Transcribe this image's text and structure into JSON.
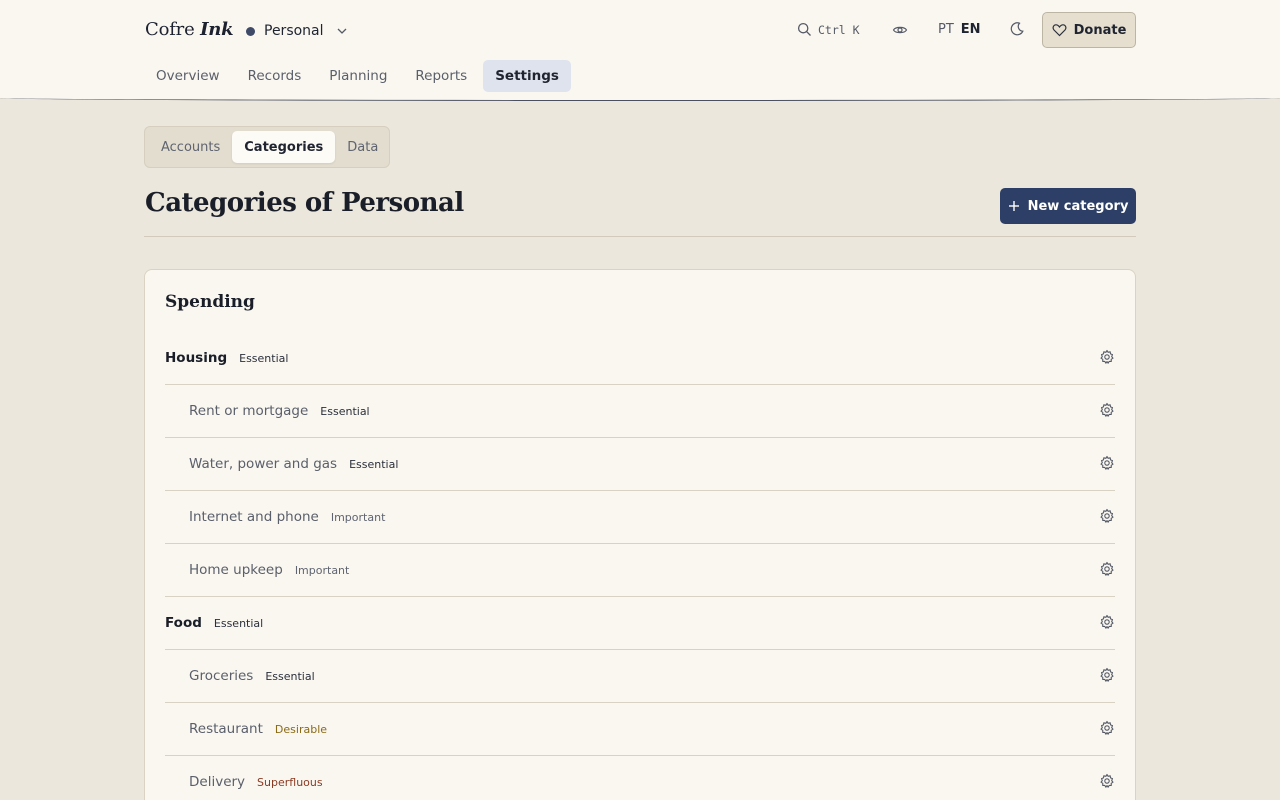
{
  "header": {
    "brand_main": "Cofre",
    "brand_accent": "Ink",
    "workspace": "Personal",
    "search_shortcut": "Ctrl K",
    "lang_pt": "PT",
    "lang_en": "EN",
    "donate_label": "Donate"
  },
  "nav": {
    "tabs": [
      {
        "label": "Overview"
      },
      {
        "label": "Records"
      },
      {
        "label": "Planning"
      },
      {
        "label": "Reports"
      },
      {
        "label": "Settings"
      }
    ],
    "active": "Settings"
  },
  "subtabs": {
    "items": [
      {
        "label": "Accounts"
      },
      {
        "label": "Categories"
      },
      {
        "label": "Data"
      }
    ],
    "active": "Categories"
  },
  "page": {
    "title": "Categories of Personal",
    "new_button": "New category"
  },
  "section": {
    "title": "Spending",
    "rows": [
      {
        "name": "Housing",
        "badge": "Essential",
        "level": "parent"
      },
      {
        "name": "Rent or mortgage",
        "badge": "Essential",
        "level": "child"
      },
      {
        "name": "Water, power and gas",
        "badge": "Essential",
        "level": "child"
      },
      {
        "name": "Internet and phone",
        "badge": "Important",
        "level": "child"
      },
      {
        "name": "Home upkeep",
        "badge": "Important",
        "level": "child"
      },
      {
        "name": "Food",
        "badge": "Essential",
        "level": "parent"
      },
      {
        "name": "Groceries",
        "badge": "Essential",
        "level": "child"
      },
      {
        "name": "Restaurant",
        "badge": "Desirable",
        "level": "child"
      },
      {
        "name": "Delivery",
        "badge": "Superfluous",
        "level": "child"
      }
    ]
  },
  "colors": {
    "accent": "#2d3f66",
    "workspace_dot": "#3e4a68",
    "desirable": "#8a6a14",
    "superfluous": "#8a3a22"
  }
}
